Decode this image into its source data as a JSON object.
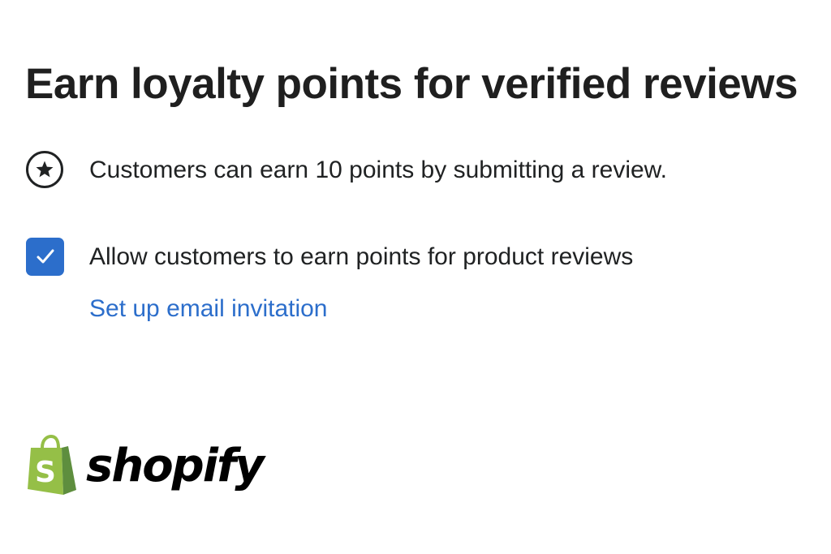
{
  "page": {
    "title": "Earn loyalty points for verified reviews"
  },
  "info": {
    "icon": "star-circle-icon",
    "text": "Customers can earn 10 points by submitting a review."
  },
  "setting": {
    "checked": true,
    "label": "Allow customers to earn points for product reviews",
    "link_label": "Set up email invitation"
  },
  "brand": {
    "name": "shopify",
    "icon": "shopify-bag-icon",
    "colors": {
      "bag_light": "#95bf47",
      "bag_dark": "#5e8e3e",
      "accent": "#2c6ecb"
    }
  }
}
